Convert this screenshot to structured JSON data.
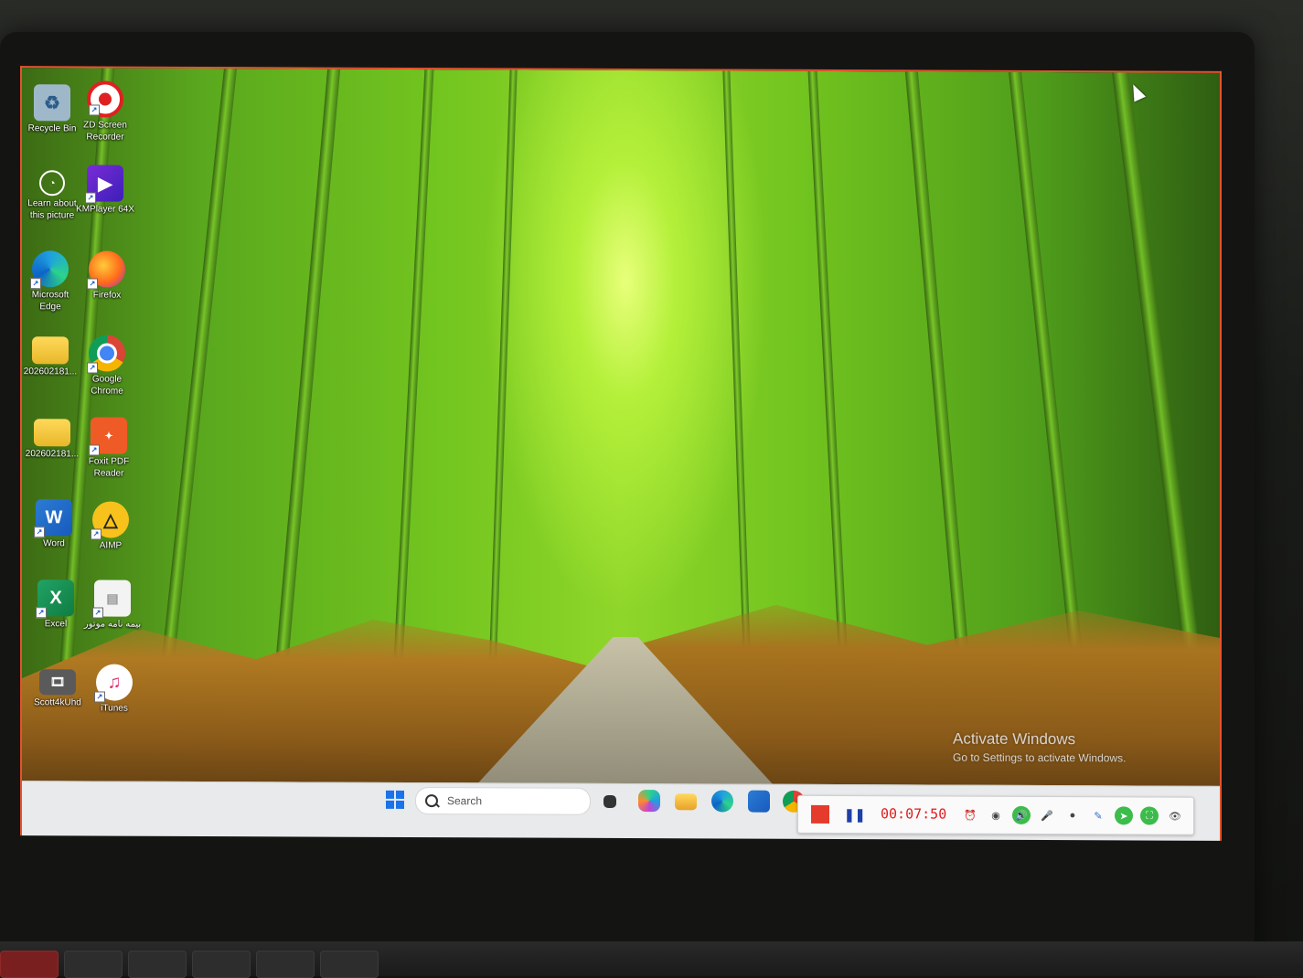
{
  "desktop_icons": [
    {
      "id": "recycle-bin",
      "label": "Recycle Bin",
      "icon": "recycle-bin-icon"
    },
    {
      "id": "zd-screen-recorder",
      "label": "ZD Screen Recorder",
      "icon": "record-icon"
    },
    {
      "id": "learn-about-picture",
      "label": "Learn about this picture",
      "icon": "info-camera-icon"
    },
    {
      "id": "kmplayer",
      "label": "KMPlayer 64X",
      "icon": "play-icon"
    },
    {
      "id": "microsoft-edge",
      "label": "Microsoft Edge",
      "icon": "edge-icon"
    },
    {
      "id": "firefox",
      "label": "Firefox",
      "icon": "firefox-icon"
    },
    {
      "id": "folder-1",
      "label": "202602181...",
      "icon": "folder-icon"
    },
    {
      "id": "google-chrome",
      "label": "Google Chrome",
      "icon": "chrome-icon"
    },
    {
      "id": "folder-2",
      "label": "202602181...",
      "icon": "folder-icon"
    },
    {
      "id": "foxit-pdf",
      "label": "Foxit PDF Reader",
      "icon": "pdf-reader-icon"
    },
    {
      "id": "word",
      "label": "Word",
      "icon": "word-icon"
    },
    {
      "id": "aimp",
      "label": "AIMP",
      "icon": "aimp-icon"
    },
    {
      "id": "excel",
      "label": "Excel",
      "icon": "excel-icon"
    },
    {
      "id": "arabic-file",
      "label": "بيمه نامه موتور",
      "icon": "document-icon"
    },
    {
      "id": "scott4kuhd",
      "label": "Scott4kUhd",
      "icon": "video-icon"
    },
    {
      "id": "itunes",
      "label": "iTunes",
      "icon": "music-note-icon"
    }
  ],
  "watermark": {
    "title": "Activate Windows",
    "subtitle": "Go to Settings to activate Windows."
  },
  "taskbar": {
    "search_placeholder": "Search",
    "apps": [
      "task-view-icon",
      "copilot-icon",
      "file-explorer-icon",
      "edge-icon",
      "store-icon",
      "chrome-icon"
    ]
  },
  "recorder": {
    "timer": "00:07:50"
  },
  "colors": {
    "recorder_stop": "#e53b2c",
    "recorder_timer": "#e01b1b",
    "screen_edge": "#e5532d"
  }
}
